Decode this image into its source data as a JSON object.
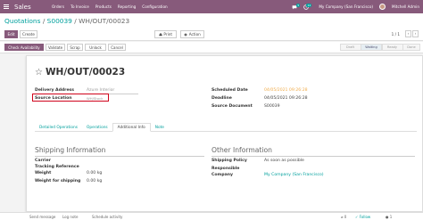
{
  "nav": {
    "app_name": "Sales",
    "menu": [
      "Orders",
      "To Invoice",
      "Products",
      "Reporting",
      "Configuration"
    ],
    "company": "My Company (San Francisco)",
    "user": "Mitchell Admin",
    "chat_badge": "5",
    "activity_badge": "12"
  },
  "breadcrumb": {
    "level1": "Quotations",
    "sep1": " / ",
    "level2": "S00039",
    "sep2": " / ",
    "current": "WH/OUT/00023"
  },
  "control_panel": {
    "edit": "Edit",
    "create": "Create",
    "print": "Print",
    "action": "Action",
    "pager": "1 / 1"
  },
  "statusbar": {
    "buttons": [
      "Check Availability",
      "Validate",
      "Scrap",
      "Unlock",
      "Cancel"
    ],
    "stages": [
      "Draft",
      "Waiting",
      "Ready",
      "Done"
    ],
    "active_stage": "Waiting"
  },
  "record": {
    "title": "WH/OUT/00023",
    "delivery_address_label": "Delivery Address",
    "delivery_address_value": "Azure Interior",
    "source_location_label": "Source Location",
    "source_location_value": "WH/Stock",
    "scheduled_date_label": "Scheduled Date",
    "scheduled_date_value": "04/05/2021 09:26:28",
    "deadline_label": "Deadline",
    "deadline_value": "04/05/2021 09:26:28",
    "source_document_label": "Source Document",
    "source_document_value": "S00039"
  },
  "tabs": [
    "Detailed Operations",
    "Operations",
    "Additional Info",
    "Note"
  ],
  "shipping": {
    "title": "Shipping Information",
    "carrier_label": "Carrier",
    "tracking_label": "Tracking Reference",
    "weight_label": "Weight",
    "weight_value": "0.00 kg",
    "weight_ship_label": "Weight for shipping",
    "weight_ship_value": "0.00 kg"
  },
  "other": {
    "title": "Other Information",
    "policy_label": "Shipping Policy",
    "policy_value": "As soon as possible",
    "responsible_label": "Responsible",
    "company_label": "Company",
    "company_value": "My Company (San Francisco)"
  },
  "chatter": {
    "send_message": "Send message",
    "log_note": "Log note",
    "schedule_activity": "Schedule activity",
    "attachments": "0",
    "follow": "Follow",
    "followers": "1"
  },
  "colors": {
    "brand": "#875a7b",
    "link": "#00a09d",
    "highlight": "#d0021b"
  }
}
